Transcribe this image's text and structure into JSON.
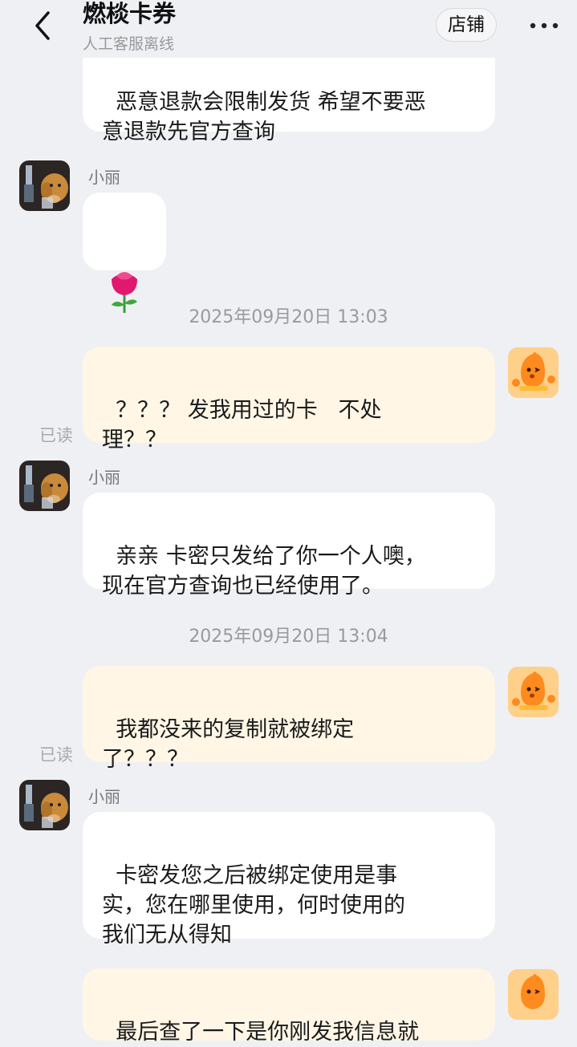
{
  "header": {
    "title": "燃棪卡券",
    "subtitle": "人工客服离线",
    "shop_label": "店铺"
  },
  "messages": [
    {
      "side": "left",
      "text": "恶意退款会限制发货 希望不要恶\n意退款先官方查询"
    },
    {
      "side": "left",
      "sender": "小丽",
      "emoji": "🌹"
    },
    {
      "time": "2025年09月20日 13:03"
    },
    {
      "side": "right",
      "text": "？？？ 发我用过的卡   不处\n理？？",
      "status": "已读"
    },
    {
      "side": "left",
      "sender": "小丽",
      "text": "亲亲 卡密只发给了你一个人噢，\n现在官方查询也已经使用了。"
    },
    {
      "time": "2025年09月20日 13:04"
    },
    {
      "side": "right",
      "text": "我都没来的复制就被绑定\n了？？？",
      "status": "已读"
    },
    {
      "side": "left",
      "sender": "小丽",
      "text": "卡密发您之后被绑定使用是事\n实，您在哪里使用，何时使用的\n我们无从得知"
    },
    {
      "side": "right",
      "text": "最后查了一下是你刚发我信息就"
    }
  ],
  "colors": {
    "background": "#eef0f4",
    "left_bubble": "#ffffff",
    "right_bubble": "#fff6e6"
  }
}
